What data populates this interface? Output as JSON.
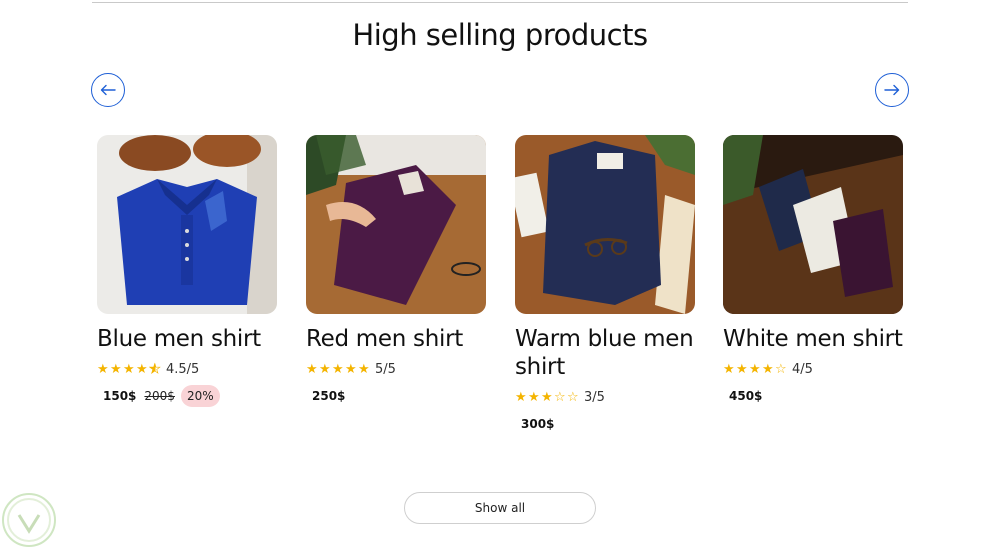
{
  "section": {
    "title": "High selling products",
    "show_all_label": "Show all"
  },
  "carousel": {
    "prev_icon": "arrow-left-icon",
    "next_icon": "arrow-right-icon",
    "accent_color": "#1e5fd6"
  },
  "products": [
    {
      "name": "Blue men shirt",
      "rating": 4.5,
      "rating_text": "4.5/5",
      "price": "150$",
      "old_price": "200$",
      "discount": "20%"
    },
    {
      "name": "Red men shirt",
      "rating": 5,
      "rating_text": "5/5",
      "price": "250$"
    },
    {
      "name": "Warm blue men shirt",
      "rating": 3,
      "rating_text": "3/5",
      "price": "300$"
    },
    {
      "name": "White men shirt",
      "rating": 4,
      "rating_text": "4/5",
      "price": "450$"
    }
  ],
  "colors": {
    "star": "#f4b400",
    "discount_bg": "#f9d3d6"
  }
}
